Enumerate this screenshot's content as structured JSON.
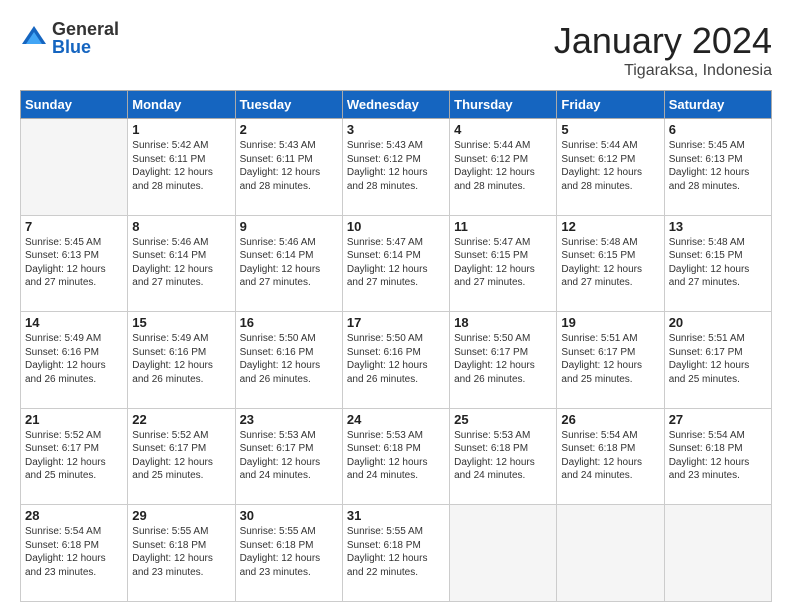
{
  "header": {
    "logo_general": "General",
    "logo_blue": "Blue",
    "main_title": "January 2024",
    "subtitle": "Tigaraksa, Indonesia"
  },
  "weekdays": [
    "Sunday",
    "Monday",
    "Tuesday",
    "Wednesday",
    "Thursday",
    "Friday",
    "Saturday"
  ],
  "weeks": [
    [
      {
        "day": "",
        "info": ""
      },
      {
        "day": "1",
        "info": "Sunrise: 5:42 AM\nSunset: 6:11 PM\nDaylight: 12 hours\nand 28 minutes."
      },
      {
        "day": "2",
        "info": "Sunrise: 5:43 AM\nSunset: 6:11 PM\nDaylight: 12 hours\nand 28 minutes."
      },
      {
        "day": "3",
        "info": "Sunrise: 5:43 AM\nSunset: 6:12 PM\nDaylight: 12 hours\nand 28 minutes."
      },
      {
        "day": "4",
        "info": "Sunrise: 5:44 AM\nSunset: 6:12 PM\nDaylight: 12 hours\nand 28 minutes."
      },
      {
        "day": "5",
        "info": "Sunrise: 5:44 AM\nSunset: 6:12 PM\nDaylight: 12 hours\nand 28 minutes."
      },
      {
        "day": "6",
        "info": "Sunrise: 5:45 AM\nSunset: 6:13 PM\nDaylight: 12 hours\nand 28 minutes."
      }
    ],
    [
      {
        "day": "7",
        "info": "Sunrise: 5:45 AM\nSunset: 6:13 PM\nDaylight: 12 hours\nand 27 minutes."
      },
      {
        "day": "8",
        "info": "Sunrise: 5:46 AM\nSunset: 6:14 PM\nDaylight: 12 hours\nand 27 minutes."
      },
      {
        "day": "9",
        "info": "Sunrise: 5:46 AM\nSunset: 6:14 PM\nDaylight: 12 hours\nand 27 minutes."
      },
      {
        "day": "10",
        "info": "Sunrise: 5:47 AM\nSunset: 6:14 PM\nDaylight: 12 hours\nand 27 minutes."
      },
      {
        "day": "11",
        "info": "Sunrise: 5:47 AM\nSunset: 6:15 PM\nDaylight: 12 hours\nand 27 minutes."
      },
      {
        "day": "12",
        "info": "Sunrise: 5:48 AM\nSunset: 6:15 PM\nDaylight: 12 hours\nand 27 minutes."
      },
      {
        "day": "13",
        "info": "Sunrise: 5:48 AM\nSunset: 6:15 PM\nDaylight: 12 hours\nand 27 minutes."
      }
    ],
    [
      {
        "day": "14",
        "info": "Sunrise: 5:49 AM\nSunset: 6:16 PM\nDaylight: 12 hours\nand 26 minutes."
      },
      {
        "day": "15",
        "info": "Sunrise: 5:49 AM\nSunset: 6:16 PM\nDaylight: 12 hours\nand 26 minutes."
      },
      {
        "day": "16",
        "info": "Sunrise: 5:50 AM\nSunset: 6:16 PM\nDaylight: 12 hours\nand 26 minutes."
      },
      {
        "day": "17",
        "info": "Sunrise: 5:50 AM\nSunset: 6:16 PM\nDaylight: 12 hours\nand 26 minutes."
      },
      {
        "day": "18",
        "info": "Sunrise: 5:50 AM\nSunset: 6:17 PM\nDaylight: 12 hours\nand 26 minutes."
      },
      {
        "day": "19",
        "info": "Sunrise: 5:51 AM\nSunset: 6:17 PM\nDaylight: 12 hours\nand 25 minutes."
      },
      {
        "day": "20",
        "info": "Sunrise: 5:51 AM\nSunset: 6:17 PM\nDaylight: 12 hours\nand 25 minutes."
      }
    ],
    [
      {
        "day": "21",
        "info": "Sunrise: 5:52 AM\nSunset: 6:17 PM\nDaylight: 12 hours\nand 25 minutes."
      },
      {
        "day": "22",
        "info": "Sunrise: 5:52 AM\nSunset: 6:17 PM\nDaylight: 12 hours\nand 25 minutes."
      },
      {
        "day": "23",
        "info": "Sunrise: 5:53 AM\nSunset: 6:17 PM\nDaylight: 12 hours\nand 24 minutes."
      },
      {
        "day": "24",
        "info": "Sunrise: 5:53 AM\nSunset: 6:18 PM\nDaylight: 12 hours\nand 24 minutes."
      },
      {
        "day": "25",
        "info": "Sunrise: 5:53 AM\nSunset: 6:18 PM\nDaylight: 12 hours\nand 24 minutes."
      },
      {
        "day": "26",
        "info": "Sunrise: 5:54 AM\nSunset: 6:18 PM\nDaylight: 12 hours\nand 24 minutes."
      },
      {
        "day": "27",
        "info": "Sunrise: 5:54 AM\nSunset: 6:18 PM\nDaylight: 12 hours\nand 23 minutes."
      }
    ],
    [
      {
        "day": "28",
        "info": "Sunrise: 5:54 AM\nSunset: 6:18 PM\nDaylight: 12 hours\nand 23 minutes."
      },
      {
        "day": "29",
        "info": "Sunrise: 5:55 AM\nSunset: 6:18 PM\nDaylight: 12 hours\nand 23 minutes."
      },
      {
        "day": "30",
        "info": "Sunrise: 5:55 AM\nSunset: 6:18 PM\nDaylight: 12 hours\nand 23 minutes."
      },
      {
        "day": "31",
        "info": "Sunrise: 5:55 AM\nSunset: 6:18 PM\nDaylight: 12 hours\nand 22 minutes."
      },
      {
        "day": "",
        "info": ""
      },
      {
        "day": "",
        "info": ""
      },
      {
        "day": "",
        "info": ""
      }
    ]
  ]
}
